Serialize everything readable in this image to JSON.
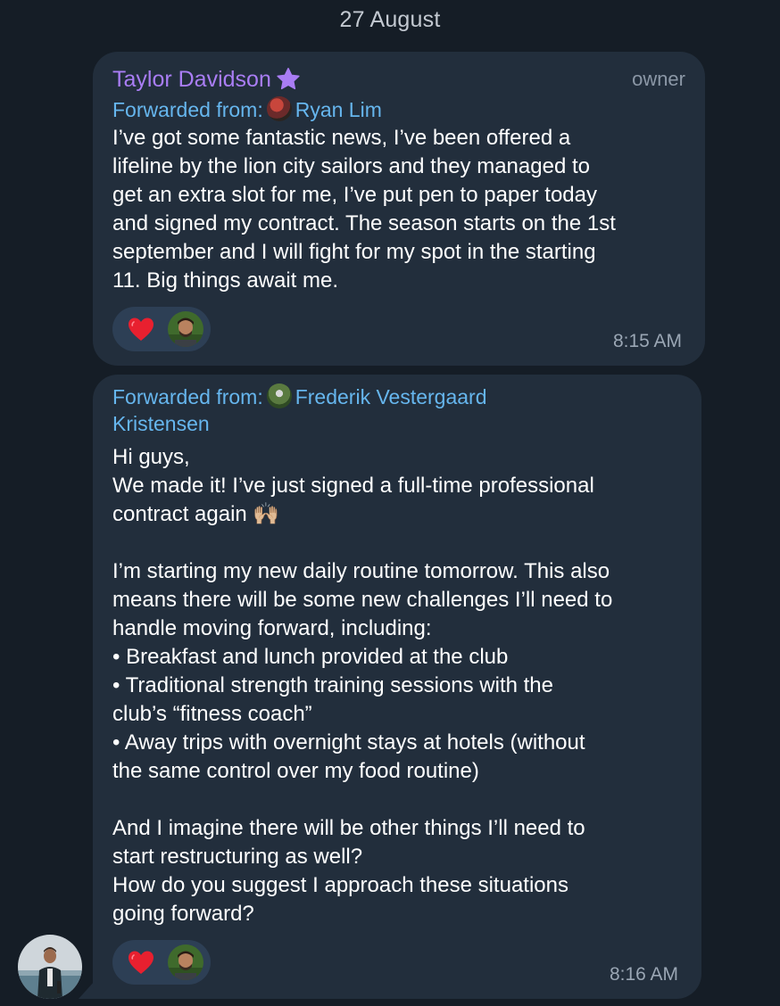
{
  "date_label": "27 August",
  "colors": {
    "background": "#151d26",
    "bubble": "#222e3c",
    "sender_name": "#a97df4",
    "forward_link": "#66b6ee",
    "reaction_pill": "#2d3f55",
    "heart": "#e8202f"
  },
  "messages": [
    {
      "sender_name": "Taylor Davidson",
      "sender_badge_icon": "star-icon",
      "role": "owner",
      "forwarded_prefix": "Forwarded from:",
      "forwarded_name": "Ryan Lim",
      "text": "I’ve got some fantastic news, I’ve been offered a\nlifeline by the lion city sailors and they managed to\nget an extra slot for me, I’ve put pen to paper today\nand signed my contract. The season starts on the 1st\nseptember and I will fight for my spot in the starting\n11. Big things await me.",
      "reaction_icon": "heart-icon",
      "time": "8:15 AM"
    },
    {
      "forwarded_prefix": "Forwarded from:",
      "forwarded_name": "Frederik Vestergaard",
      "forwarded_name_line2": "Kristensen",
      "text": "Hi guys,\nWe made it! I’ve just signed a full-time professional\ncontract again 🙌🏼\n\nI’m starting my new daily routine tomorrow. This also\nmeans there will be some new challenges I’ll need to\nhandle moving forward, including:\n • Breakfast and lunch provided at the club\n • Traditional strength training sessions with the\nclub’s “fitness coach”\n • Away trips with overnight stays at hotels (without\nthe same control over my food routine)\n\nAnd I imagine there will be other things I’ll need to\nstart restructuring as well?\nHow do you suggest I approach these situations\ngoing forward?",
      "reaction_icon": "heart-icon",
      "time": "8:16 AM"
    }
  ]
}
